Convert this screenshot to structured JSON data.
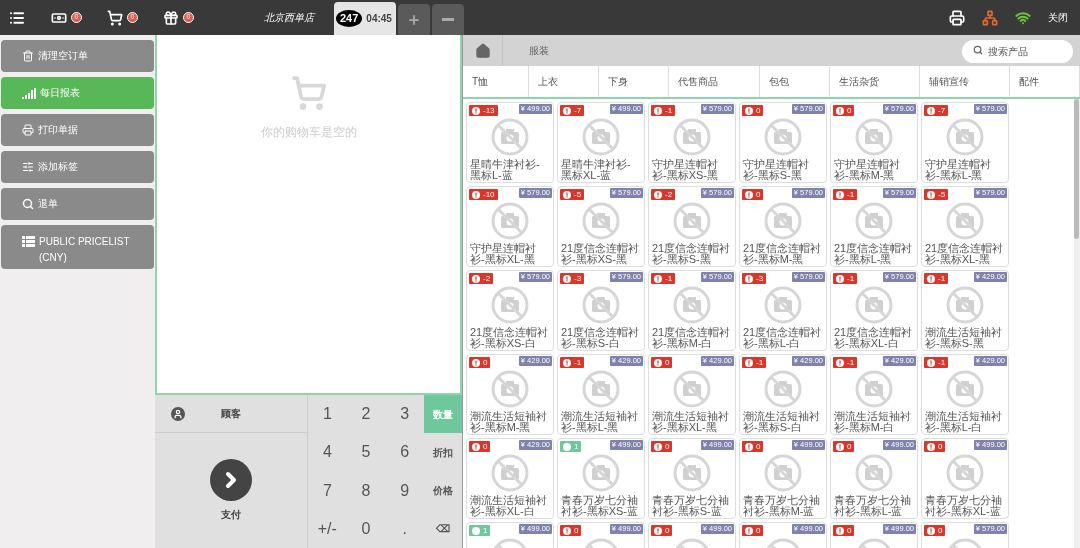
{
  "top_bar": {
    "counters": [
      {
        "kind": "cash",
        "count": "0"
      },
      {
        "kind": "cart",
        "count": "0"
      },
      {
        "kind": "gift",
        "count": "0"
      }
    ],
    "store_name": "北京西单店",
    "order_tabs": [
      {
        "number": "247",
        "time": "04:45",
        "selected": true
      }
    ],
    "close_label": "关闭"
  },
  "sidebar": {
    "buttons": [
      {
        "kind": "trash",
        "label": "清理空订单",
        "selected": false
      },
      {
        "kind": "report",
        "label": "每日报表",
        "selected": true
      },
      {
        "kind": "print",
        "label": "打印单据",
        "selected": false
      },
      {
        "kind": "tags",
        "label": "添加标签",
        "selected": false
      },
      {
        "kind": "search",
        "label": "退单",
        "selected": false
      },
      {
        "kind": "list",
        "label": "PUBLIC PRICELIST (CNY)",
        "selected": false
      }
    ]
  },
  "order": {
    "empty_message": "你的购物车是空的"
  },
  "numpad": {
    "customer_label": "顾客",
    "pay_label": "支付",
    "keys": [
      "1",
      "2",
      "3",
      "4",
      "5",
      "6",
      "7",
      "8",
      "9",
      "+/-",
      "0",
      "."
    ],
    "modes": [
      {
        "label": "数量",
        "selected": true
      },
      {
        "label": "折扣",
        "selected": false
      },
      {
        "label": "价格",
        "selected": false
      },
      {
        "label": "⌫",
        "selected": false
      }
    ]
  },
  "breadcrumb": {
    "category": "服装"
  },
  "search": {
    "placeholder": "搜索产品"
  },
  "categories": [
    "T恤",
    "上衣",
    "下身",
    "代售商品",
    "包包",
    "生活杂货",
    "辅销宣传",
    "配件"
  ],
  "products": [
    {
      "name": "星晴牛津衬衫-黑标L-蓝",
      "stock": "-13",
      "kind": "warning",
      "price": "¥ 499.00"
    },
    {
      "name": "星晴牛津衬衫-黑标XL-蓝",
      "stock": "-7",
      "kind": "warning",
      "price": "¥ 499.00"
    },
    {
      "name": "守护星连帽衬衫-黑标XS-黑",
      "stock": "-1",
      "kind": "warning",
      "price": "¥ 579.00"
    },
    {
      "name": "守护星连帽衬衫-黑标S-黑",
      "stock": "0",
      "kind": "warning",
      "price": "¥ 579.00"
    },
    {
      "name": "守护星连帽衬衫-黑标M-黑",
      "stock": "0",
      "kind": "warning",
      "price": "¥ 579.00"
    },
    {
      "name": "守护星连帽衬衫-黑标L-黑",
      "stock": "-7",
      "kind": "warning",
      "price": "¥ 579.00"
    },
    {
      "name": "守护星连帽衬衫-黑标XL-黑",
      "stock": "-10",
      "kind": "warning",
      "price": "¥ 579.00"
    },
    {
      "name": "21度信念连帽衬衫-黑标XS-黑",
      "stock": "-5",
      "kind": "warning",
      "price": "¥ 579.00"
    },
    {
      "name": "21度信念连帽衬衫-黑标S-黑",
      "stock": "-2",
      "kind": "warning",
      "price": "¥ 579.00"
    },
    {
      "name": "21度信念连帽衬衫-黑标M-黑",
      "stock": "0",
      "kind": "warning",
      "price": "¥ 579.00"
    },
    {
      "name": "21度信念连帽衬衫-黑标L-黑",
      "stock": "-1",
      "kind": "warning",
      "price": "¥ 579.00"
    },
    {
      "name": "21度信念连帽衬衫-黑标XL-黑",
      "stock": "-5",
      "kind": "warning",
      "price": "¥ 579.00"
    },
    {
      "name": "21度信念连帽衬衫-黑标XS-白",
      "stock": "-2",
      "kind": "warning",
      "price": "¥ 579.00"
    },
    {
      "name": "21度信念连帽衬衫-黑标S-白",
      "stock": "-3",
      "kind": "warning",
      "price": "¥ 579.00"
    },
    {
      "name": "21度信念连帽衬衫-黑标M-白",
      "stock": "-1",
      "kind": "warning",
      "price": "¥ 579.00"
    },
    {
      "name": "21度信念连帽衬衫-黑标L-白",
      "stock": "-3",
      "kind": "warning",
      "price": "¥ 579.00"
    },
    {
      "name": "21度信念连帽衬衫-黑标XL-白",
      "stock": "-1",
      "kind": "warning",
      "price": "¥ 579.00"
    },
    {
      "name": "潮流生活短袖衬衫-黑标S-黑",
      "stock": "-1",
      "kind": "warning",
      "price": "¥ 429.00"
    },
    {
      "name": "潮流生活短袖衬衫-黑标M-黑",
      "stock": "0",
      "kind": "warning",
      "price": "¥ 429.00"
    },
    {
      "name": "潮流生活短袖衬衫-黑标L-黑",
      "stock": "-1",
      "kind": "warning",
      "price": "¥ 429.00"
    },
    {
      "name": "潮流生活短袖衬衫-黑标XL-黑",
      "stock": "0",
      "kind": "warning",
      "price": "¥ 429.00"
    },
    {
      "name": "潮流生活短袖衬衫-黑标S-白",
      "stock": "-1",
      "kind": "warning",
      "price": "¥ 429.00"
    },
    {
      "name": "潮流生活短袖衬衫-黑标M-白",
      "stock": "-1",
      "kind": "warning",
      "price": "¥ 429.00"
    },
    {
      "name": "潮流生活短袖衬衫-黑标L-白",
      "stock": "-1",
      "kind": "warning",
      "price": "¥ 429.00"
    },
    {
      "name": "潮流生活短袖衬衫-黑标XL-白",
      "stock": "0",
      "kind": "warning",
      "price": "¥ 429.00"
    },
    {
      "name": "青春万岁七分袖衬衫-黑标XS-蓝",
      "stock": "1",
      "kind": "available",
      "price": "¥ 499.00"
    },
    {
      "name": "青春万岁七分袖衬衫-黑标S-蓝",
      "stock": "0",
      "kind": "warning",
      "price": "¥ 499.00"
    },
    {
      "name": "青春万岁七分袖衬衫-黑标M-蓝",
      "stock": "0",
      "kind": "warning",
      "price": "¥ 499.00"
    },
    {
      "name": "青春万岁七分袖衬衫-黑标L-蓝",
      "stock": "0",
      "kind": "warning",
      "price": "¥ 499.00"
    },
    {
      "name": "青春万岁七分袖衬衫-黑标XL-蓝",
      "stock": "0",
      "kind": "warning",
      "price": "¥ 499.00"
    },
    {
      "stock": "1",
      "kind": "available",
      "price": "¥ 499.00"
    },
    {
      "stock": "0",
      "kind": "warning",
      "price": "¥ 499.00"
    },
    {
      "stock": "0",
      "kind": "warning",
      "price": "¥ 499.00"
    },
    {
      "stock": "0",
      "kind": "warning",
      "price": "¥ 499.00"
    },
    {
      "stock": "0",
      "kind": "warning",
      "price": "¥ 499.00"
    },
    {
      "stock": "0",
      "kind": "warning",
      "price": "¥ 579.00"
    }
  ]
}
